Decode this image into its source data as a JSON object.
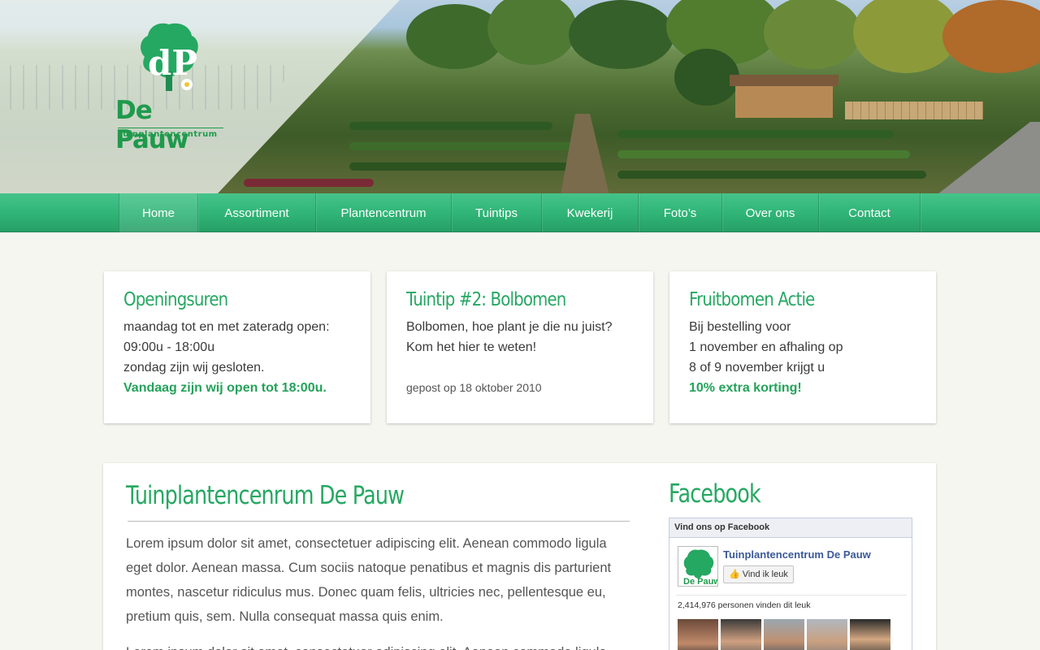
{
  "brand": {
    "name": "De Pauw",
    "subtitle": "Tuinplantencentrum",
    "mark": "dP",
    "colors": {
      "primary": "#25a862",
      "nav": "#2fb476"
    }
  },
  "nav": {
    "items": [
      {
        "label": "Home",
        "active": true
      },
      {
        "label": "Assortiment"
      },
      {
        "label": "Plantencentrum"
      },
      {
        "label": "Tuintips"
      },
      {
        "label": "Kwekerij"
      },
      {
        "label": "Foto’s"
      },
      {
        "label": "Over ons"
      },
      {
        "label": "Contact"
      }
    ]
  },
  "cards": [
    {
      "title": "Openingsuren",
      "lines": [
        "maandag tot en met zateradg open:",
        "09:00u - 18:00u",
        "zondag zijn wij gesloten."
      ],
      "highlight": "Vandaag zijn wij open tot 18:00u."
    },
    {
      "title": "Tuintip #2: Bolbomen",
      "lines": [
        "Bolbomen, hoe plant je die nu juist?",
        "Kom het hier te weten!"
      ],
      "meta": "gepost op 18 oktober 2010"
    },
    {
      "title": "Fruitbomen Actie",
      "lines": [
        "Bij bestelling voor",
        "1 november en afhaling op",
        "8 of 9 november krijgt u"
      ],
      "highlight": "10% extra korting!"
    }
  ],
  "main": {
    "title": "Tuinplantencenrum De Pauw",
    "paragraph": "Lorem ipsum dolor sit amet, consectetuer adipiscing elit. Aenean commodo ligula eget dolor. Aenean massa. Cum sociis natoque penatibus et magnis dis parturient montes, nascetur ridiculus mus. Donec quam felis, ultricies nec, pellentesque eu, pretium quis, sem. Nulla consequat massa quis enim.",
    "paragraph2": "Lorem ipsum dolor sit amet, consectetuer adipiscing elit. Aenean commodo ligula"
  },
  "facebook": {
    "title": "Facebook",
    "box_header": "Vind ons op Facebook",
    "page_name": "Tuinplantencentrum De Pauw",
    "like_label": "Vind ik leuk",
    "count_text": "2,414,976 personen vinden dit leuk",
    "thumb_label": "De Pauw",
    "icons": [
      "thumbs-up-icon"
    ]
  }
}
